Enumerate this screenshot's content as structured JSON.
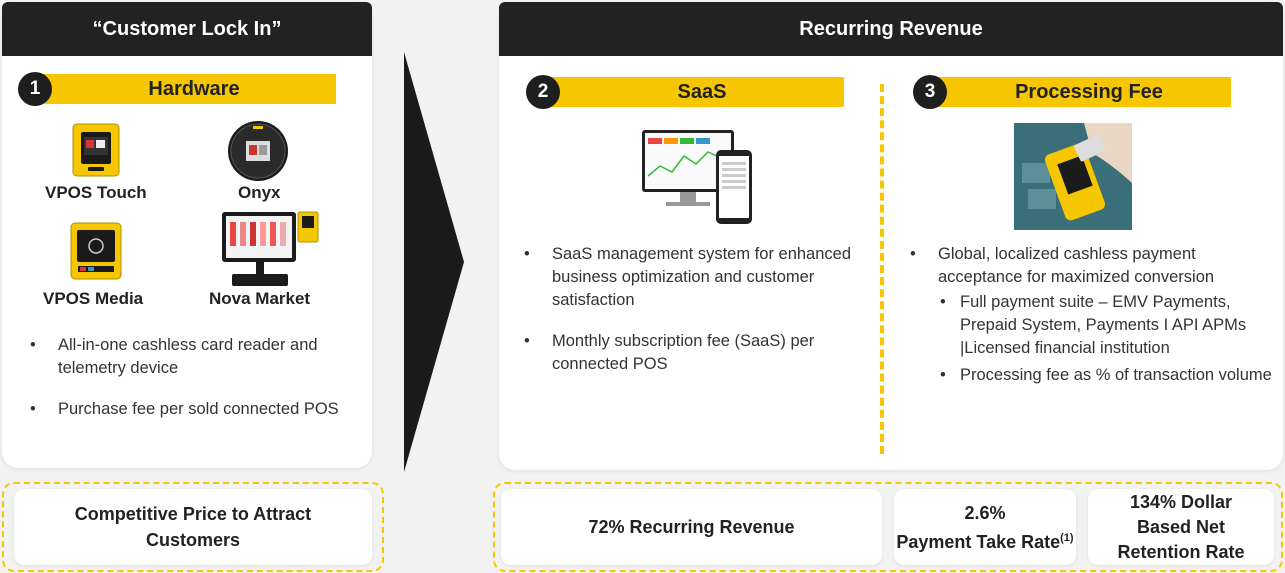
{
  "left": {
    "header": "“Customer Lock In”",
    "badge_number": "1",
    "badge_title": "Hardware",
    "devices": [
      {
        "label": "VPOS Touch",
        "icon": "vpos-touch-device-image"
      },
      {
        "label": "Onyx",
        "icon": "onyx-device-image"
      },
      {
        "label": "VPOS Media",
        "icon": "vpos-media-device-image"
      },
      {
        "label": "Nova Market",
        "icon": "nova-market-device-image"
      }
    ],
    "bullets": [
      "All-in-one cashless card reader and telemetry device",
      "Purchase fee per sold connected POS"
    ],
    "footer": "Competitive Price to Attract Customers"
  },
  "right": {
    "header": "Recurring Revenue",
    "saas": {
      "badge_number": "2",
      "badge_title": "SaaS",
      "bullets": [
        "SaaS management system for enhanced business optimization and customer satisfaction",
        "Monthly subscription fee (SaaS) per connected POS"
      ]
    },
    "processing": {
      "badge_number": "3",
      "badge_title": "Processing Fee",
      "bullet": "Global, localized cashless payment acceptance for maximized conversion",
      "sub_bullets": [
        "Full payment suite – EMV Payments, Prepaid System, Payments I API APMs |Licensed financial institution",
        "Processing fee as % of transaction volume"
      ]
    },
    "metrics": {
      "recurring": "72% Recurring Revenue",
      "take_rate_value": "2.6%",
      "take_rate_label": "Payment Take Rate",
      "take_rate_note": "(1)",
      "retention_value": "134% Dollar",
      "retention_label_1": "Based Net",
      "retention_label_2": "Retention Rate"
    }
  },
  "colors": {
    "accent": "#f6c700",
    "dark": "#1e1e1e"
  }
}
